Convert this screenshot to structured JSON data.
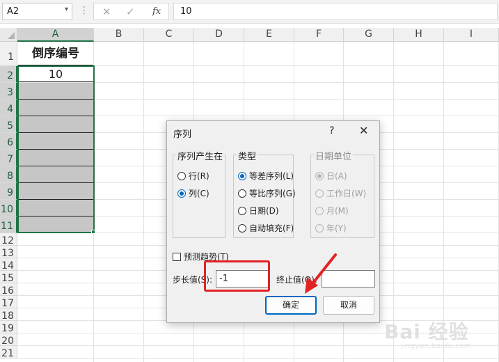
{
  "formula_bar": {
    "name_box": "A2",
    "name_box_arrow": "▾",
    "separator": "⋮",
    "cancel_icon": "✕",
    "confirm_icon": "✓",
    "fx_label": "fx",
    "content": "10"
  },
  "columns": [
    "A",
    "B",
    "C",
    "D",
    "E",
    "F",
    "G",
    "H",
    "I"
  ],
  "rows": [
    "1",
    "2",
    "3",
    "4",
    "5",
    "6",
    "7",
    "8",
    "9",
    "10",
    "11",
    "12",
    "13",
    "14",
    "15",
    "16",
    "17",
    "18",
    "19",
    "20",
    "21"
  ],
  "cells": {
    "A1": "倒序编号",
    "A2": "10"
  },
  "dialog": {
    "title": "序列",
    "help": "?",
    "close": "✕",
    "series_in": {
      "label": "序列产生在",
      "options": [
        "行(R)",
        "列(C)"
      ],
      "selected": "列(C)"
    },
    "type": {
      "label": "类型",
      "options": [
        "等差序列(L)",
        "等比序列(G)",
        "日期(D)",
        "自动填充(F)"
      ],
      "selected": "等差序列(L)"
    },
    "date_unit": {
      "label": "日期单位",
      "options": [
        "日(A)",
        "工作日(W)",
        "月(M)",
        "年(Y)"
      ],
      "selected": "日(A)",
      "disabled": true
    },
    "trend_label": "预测趋势(T)",
    "trend_checked": false,
    "step_label": "步长值(S):",
    "step_value": "-1",
    "stop_label": "终止值(O):",
    "stop_value": "",
    "ok_label": "确定",
    "cancel_label": "取消"
  },
  "watermark": {
    "text": "Bai 经验",
    "url": "jingyan.baidu.com"
  },
  "colors": {
    "excel_green": "#217346",
    "selection_fill": "#c6c6c6",
    "annotation_red": "#e32222",
    "dialog_accent": "#0067c0"
  }
}
